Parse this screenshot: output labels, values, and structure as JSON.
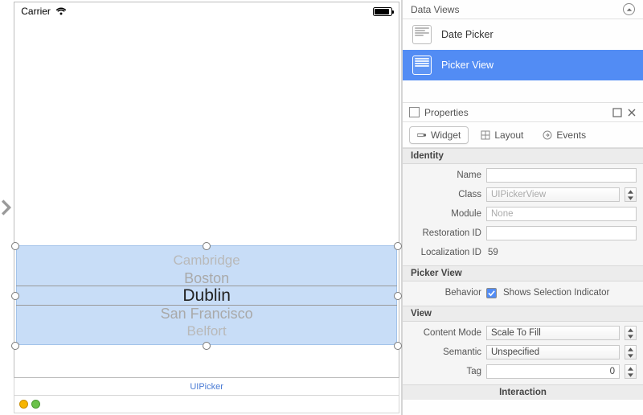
{
  "statusbar": {
    "carrier": "Carrier"
  },
  "picker": {
    "rows": [
      "Cambridge",
      "Boston",
      "Dublin",
      "San Francisco",
      "Belfort"
    ],
    "footer_label": "UIPicker"
  },
  "data_views": {
    "title": "Data Views",
    "items": [
      {
        "label": "Date Picker",
        "selected": false
      },
      {
        "label": "Picker View",
        "selected": true
      }
    ]
  },
  "properties": {
    "title": "Properties",
    "tabs": {
      "widget": "Widget",
      "layout": "Layout",
      "events": "Events"
    },
    "identity": {
      "header": "Identity",
      "name_label": "Name",
      "name_value": "",
      "class_label": "Class",
      "class_value": "UIPickerView",
      "module_label": "Module",
      "module_value": "None",
      "restoration_label": "Restoration ID",
      "restoration_value": "",
      "localization_label": "Localization ID",
      "localization_value": "59"
    },
    "picker_view": {
      "header": "Picker View",
      "behavior_label": "Behavior",
      "behavior_checkbox_label": "Shows Selection Indicator",
      "behavior_checked": true
    },
    "view": {
      "header": "View",
      "content_mode_label": "Content Mode",
      "content_mode_value": "Scale To Fill",
      "semantic_label": "Semantic",
      "semantic_value": "Unspecified",
      "tag_label": "Tag",
      "tag_value": "0"
    },
    "interaction_header": "Interaction"
  }
}
